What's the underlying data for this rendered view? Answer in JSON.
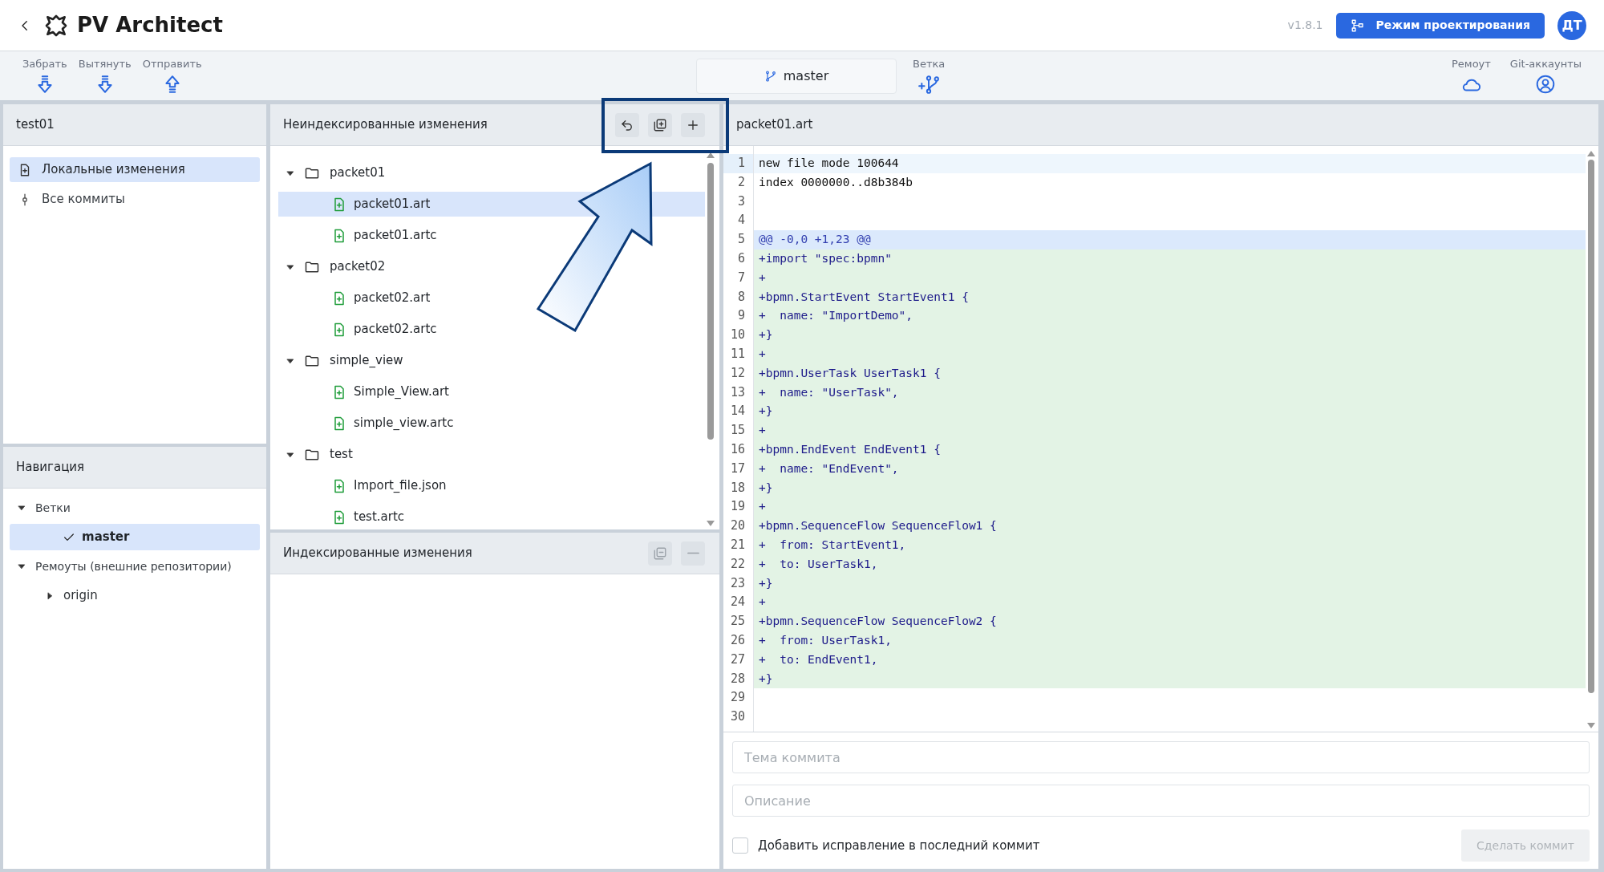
{
  "header": {
    "title": "PV Architect",
    "version": "v1.8.1",
    "mode_button": "Режим проектирования",
    "avatar": "ДТ"
  },
  "toolbar": {
    "actions": [
      {
        "label": "Забрать",
        "kind": "fetch"
      },
      {
        "label": "Вытянуть",
        "kind": "pull"
      },
      {
        "label": "Отправить",
        "kind": "push"
      }
    ],
    "branch": "master",
    "branch_action": "Ветка",
    "right_actions": [
      {
        "label": "Ремоут",
        "kind": "remote"
      },
      {
        "label": "Git-аккаунты",
        "kind": "accounts"
      }
    ]
  },
  "repo_panel": {
    "title": "test01",
    "items": [
      {
        "label": "Локальные изменения",
        "kind": "changes",
        "selected": true
      },
      {
        "label": "Все коммиты",
        "kind": "commits",
        "selected": false
      }
    ]
  },
  "navigation": {
    "title": "Навигация",
    "sections": [
      {
        "label": "Ветки",
        "expanded": true,
        "children": [
          {
            "label": "master",
            "kind": "branch",
            "current": true,
            "selected": true
          }
        ]
      },
      {
        "label": "Ремоуты (внешние репозитории)",
        "expanded": true,
        "children": [
          {
            "label": "origin",
            "kind": "remote",
            "expanded": false,
            "selected": false
          }
        ]
      }
    ]
  },
  "unstaged": {
    "title": "Неиндексированные изменения",
    "tree": [
      {
        "name": "packet01",
        "kind": "folder",
        "expanded": true,
        "children": [
          {
            "name": "packet01.art",
            "kind": "file",
            "selected": true
          },
          {
            "name": "packet01.artc",
            "kind": "file",
            "selected": false
          }
        ]
      },
      {
        "name": "packet02",
        "kind": "folder",
        "expanded": true,
        "children": [
          {
            "name": "packet02.art",
            "kind": "file",
            "selected": false
          },
          {
            "name": "packet02.artc",
            "kind": "file",
            "selected": false
          }
        ]
      },
      {
        "name": "simple_view",
        "kind": "folder",
        "expanded": true,
        "children": [
          {
            "name": "Simple_View.art",
            "kind": "file",
            "selected": false
          },
          {
            "name": "simple_view.artc",
            "kind": "file",
            "selected": false
          }
        ]
      },
      {
        "name": "test",
        "kind": "folder",
        "expanded": true,
        "children": [
          {
            "name": "Import_file.json",
            "kind": "file",
            "selected": false
          },
          {
            "name": "test.artc",
            "kind": "file",
            "selected": false
          }
        ]
      }
    ]
  },
  "staged": {
    "title": "Индексированные изменения"
  },
  "diff": {
    "filename": "packet01.art",
    "lines": [
      {
        "n": "1",
        "text": "new file mode 100644",
        "kind": "meta",
        "current": true
      },
      {
        "n": "2",
        "text": "index 0000000..d8b384b",
        "kind": "meta",
        "current": false
      },
      {
        "n": "3",
        "kind": "meta",
        "current": false
      },
      {
        "n": "4",
        "kind": "meta",
        "current": false
      },
      {
        "n": "5",
        "text": "@@ -0,0 +1,23 @@",
        "kind": "hunk",
        "current": false
      },
      {
        "n": "6",
        "text": "+import \"spec:bpmn\"",
        "kind": "add",
        "current": false
      },
      {
        "n": "7",
        "text": "+",
        "kind": "add",
        "current": false
      },
      {
        "n": "8",
        "text": "+bpmn.StartEvent StartEvent1 {",
        "kind": "add",
        "current": false
      },
      {
        "n": "9",
        "text": "+  name: \"ImportDemo\",",
        "kind": "add",
        "current": false
      },
      {
        "n": "10",
        "text": "+}",
        "kind": "add",
        "current": false
      },
      {
        "n": "11",
        "text": "+",
        "kind": "add",
        "current": false
      },
      {
        "n": "12",
        "text": "+bpmn.UserTask UserTask1 {",
        "kind": "add",
        "current": false
      },
      {
        "n": "13",
        "text": "+  name: \"UserTask\",",
        "kind": "add",
        "current": false
      },
      {
        "n": "14",
        "text": "+}",
        "kind": "add",
        "current": false
      },
      {
        "n": "15",
        "text": "+",
        "kind": "add",
        "current": false
      },
      {
        "n": "16",
        "text": "+bpmn.EndEvent EndEvent1 {",
        "kind": "add",
        "current": false
      },
      {
        "n": "17",
        "text": "+  name: \"EndEvent\",",
        "kind": "add",
        "current": false
      },
      {
        "n": "18",
        "text": "+}",
        "kind": "add",
        "current": false
      },
      {
        "n": "19",
        "text": "+",
        "kind": "add",
        "current": false
      },
      {
        "n": "20",
        "text": "+bpmn.SequenceFlow SequenceFlow1 {",
        "kind": "add",
        "current": false
      },
      {
        "n": "21",
        "text": "+  from: StartEvent1,",
        "kind": "add",
        "current": false
      },
      {
        "n": "22",
        "text": "+  to: UserTask1,",
        "kind": "add",
        "current": false
      },
      {
        "n": "23",
        "text": "+}",
        "kind": "add",
        "current": false
      },
      {
        "n": "24",
        "text": "+",
        "kind": "add",
        "current": false
      },
      {
        "n": "25",
        "text": "+bpmn.SequenceFlow SequenceFlow2 {",
        "kind": "add",
        "current": false
      },
      {
        "n": "26",
        "text": "+  from: UserTask1,",
        "kind": "add",
        "current": false
      },
      {
        "n": "27",
        "text": "+  to: EndEvent1,",
        "kind": "add",
        "current": false
      },
      {
        "n": "28",
        "text": "+}",
        "kind": "add",
        "current": false
      },
      {
        "n": "29",
        "kind": "meta",
        "current": false
      },
      {
        "n": "30",
        "kind": "meta",
        "current": false
      }
    ]
  },
  "commit": {
    "subject_placeholder": "Тема коммита",
    "description_placeholder": "Описание",
    "amend": {
      "label": "Добавить исправление в последний коммит",
      "checked": false
    },
    "button": {
      "label": "Сделать коммит",
      "disabled": true
    }
  }
}
